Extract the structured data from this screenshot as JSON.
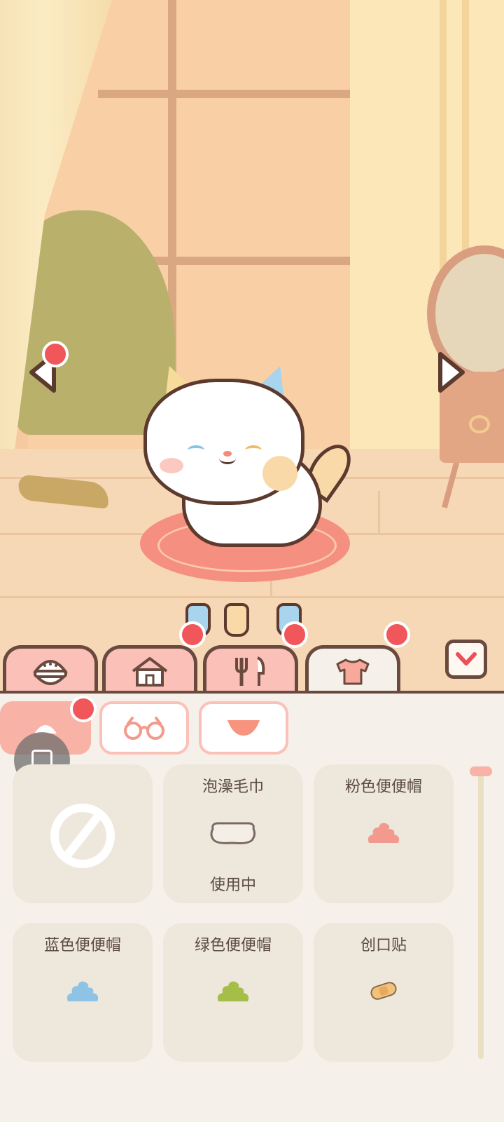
{
  "scene": {
    "colors": {
      "wall": "#F7C9A0",
      "floor": "#F6D7B6",
      "rug": "#F58F80",
      "bush": "#B9B06B",
      "curtain": "#FBE7B8"
    },
    "nav": {
      "prev_icon": "left-arrow-icon",
      "next_icon": "right-arrow-icon",
      "prev_has_badge": true
    }
  },
  "tabs": [
    {
      "id": "food",
      "icon": "food-bowl-icon",
      "active": false,
      "badge": false
    },
    {
      "id": "home",
      "icon": "house-icon",
      "active": false,
      "badge": true
    },
    {
      "id": "dining",
      "icon": "fork-knife-icon",
      "active": false,
      "badge": true
    },
    {
      "id": "clothing",
      "icon": "shirt-icon",
      "active": true,
      "badge": true
    }
  ],
  "collapse_icon": "chevron-down-icon",
  "sub_tabs": [
    {
      "id": "hat",
      "icon": "hat-icon",
      "active": true,
      "badge": true
    },
    {
      "id": "glasses",
      "icon": "glasses-icon",
      "active": false,
      "badge": false
    },
    {
      "id": "scarf",
      "icon": "bib-icon",
      "active": false,
      "badge": false
    }
  ],
  "items": [
    {
      "name": "",
      "icon": "none-icon",
      "status": ""
    },
    {
      "name": "泡澡毛巾",
      "icon": "towel-icon",
      "status": "使用中",
      "icon_color": "#F4EEE6"
    },
    {
      "name": "粉色便便帽",
      "icon": "poop-hat-icon",
      "status": "",
      "icon_color": "#F39A8E"
    },
    {
      "name": "蓝色便便帽",
      "icon": "poop-hat-icon",
      "status": "",
      "icon_color": "#8FC3E6"
    },
    {
      "name": "绿色便便帽",
      "icon": "poop-hat-icon",
      "status": "",
      "icon_color": "#A4BE47"
    },
    {
      "name": "创口贴",
      "icon": "bandage-icon",
      "status": "",
      "icon_color": "#F2C27B"
    }
  ]
}
